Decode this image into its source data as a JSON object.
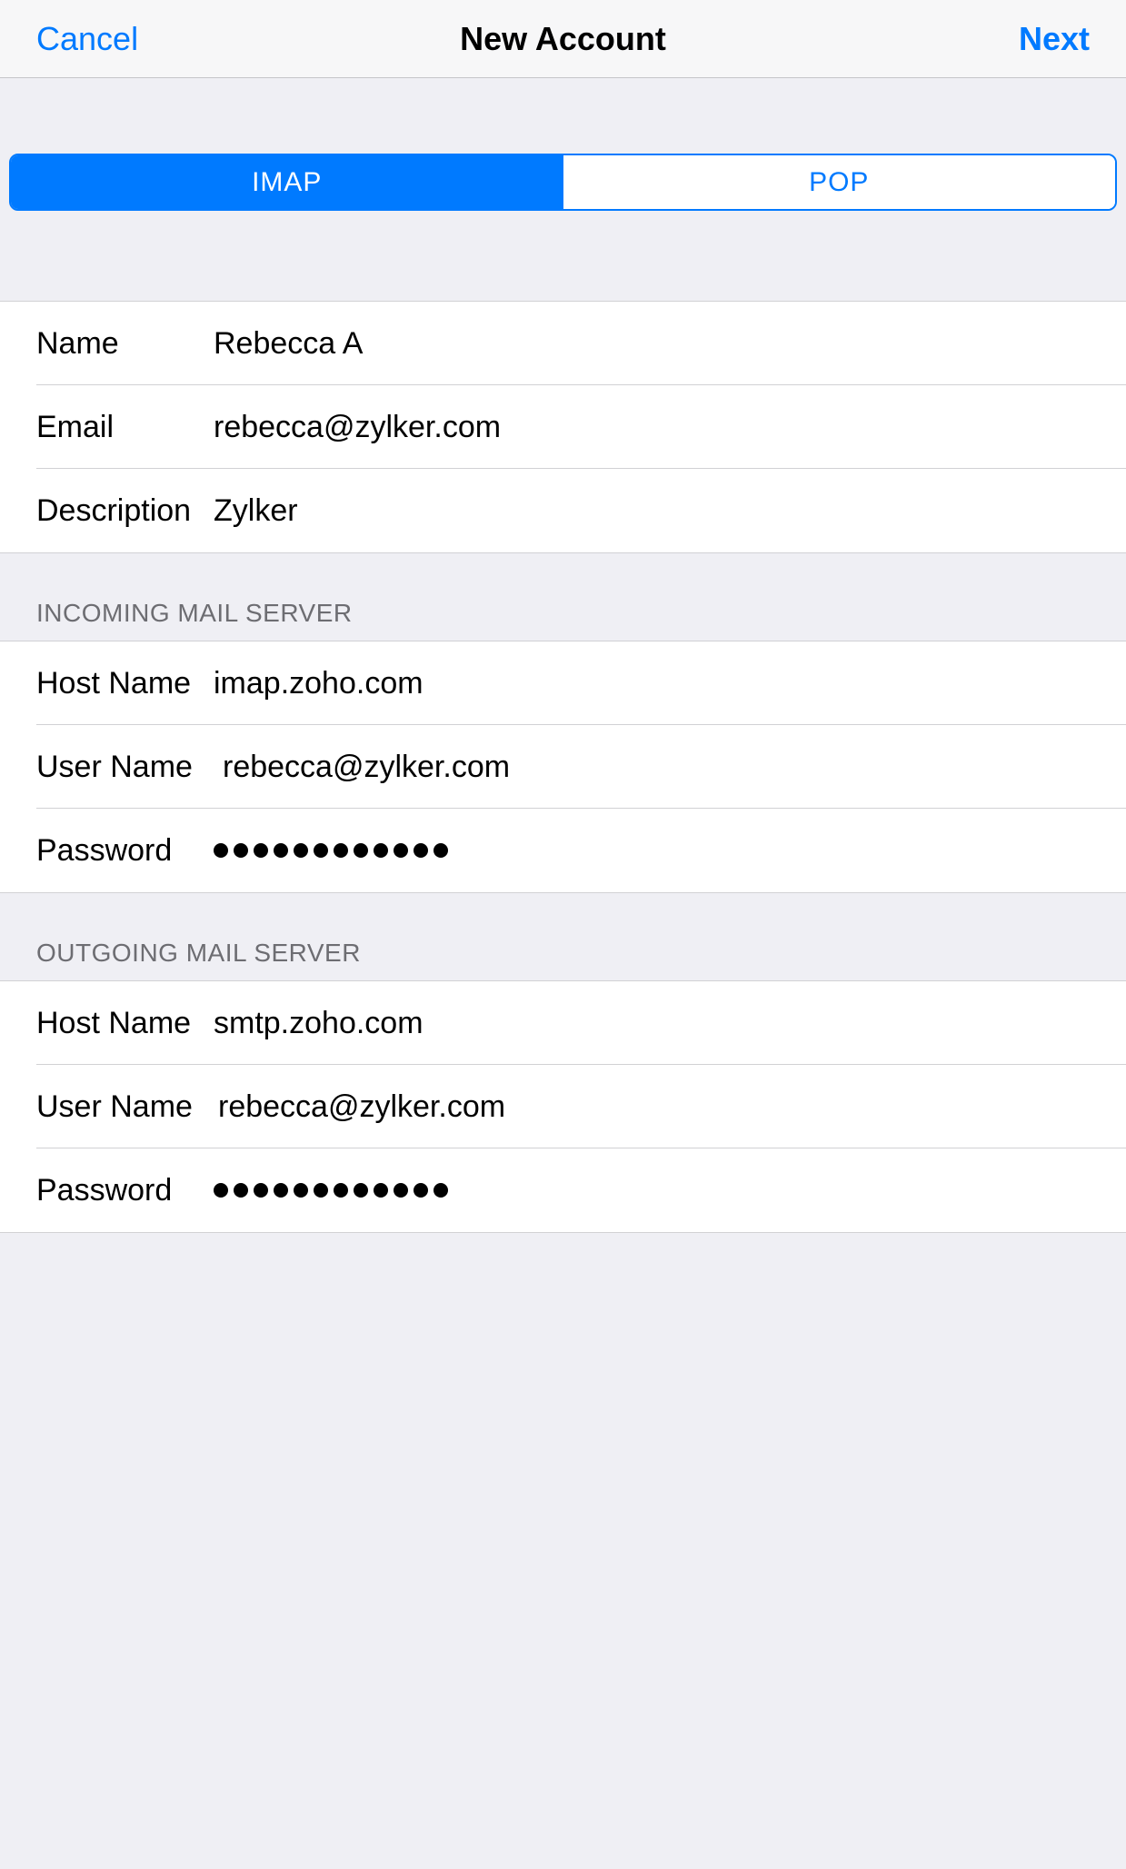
{
  "navbar": {
    "cancel": "Cancel",
    "title": "New Account",
    "next": "Next"
  },
  "segments": {
    "imap": "IMAP",
    "pop": "POP"
  },
  "account": {
    "name_label": "Name",
    "name_value": "Rebecca A",
    "email_label": "Email",
    "email_value": "rebecca@zylker.com",
    "description_label": "Description",
    "description_value": "Zylker"
  },
  "incoming": {
    "header": "INCOMING MAIL SERVER",
    "host_label": "Host Name",
    "host_value": "imap.zoho.com",
    "user_label": "User Name",
    "user_value": "rebecca@zylker.com",
    "password_label": "Password",
    "password_dots": 12
  },
  "outgoing": {
    "header": "OUTGOING MAIL SERVER",
    "host_label": "Host Name",
    "host_value": "smtp.zoho.com",
    "user_label": "User Name",
    "user_value": "rebecca@zylker.com",
    "password_label": "Password",
    "password_dots": 12
  }
}
